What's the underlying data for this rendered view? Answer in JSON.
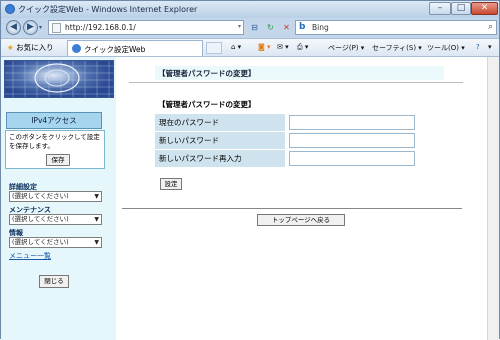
{
  "window": {
    "title": "クイック設定Web - Windows Internet Explorer"
  },
  "address_bar": {
    "url": "http://192.168.0.1/",
    "search_text": "Bing"
  },
  "favorites": {
    "label": "お気に入り"
  },
  "tab": {
    "title": "クイック設定Web"
  },
  "command_bar": {
    "page": "ページ(P) ▾",
    "safety": "セーフティ(S) ▾",
    "tools": "ツール(O) ▾",
    "help": "?",
    "more": "▾"
  },
  "sidebar": {
    "ipv4_label": "IPv4アクセス",
    "save_message": "このボタンをクリックして設定を保存します。",
    "save_button": "保存",
    "sections": [
      {
        "title": "詳細設定",
        "selected": "(選択してください)"
      },
      {
        "title": "メンテナンス",
        "selected": "(選択してください)"
      },
      {
        "title": "情報",
        "selected": "(選択してください)"
      }
    ],
    "menu_list": "メニュー一覧",
    "close_button": "閉じる"
  },
  "main": {
    "header": "【管理者パスワードの変更】",
    "form_title": "【管理者パスワードの変更】",
    "fields": [
      {
        "label": "現在のパスワード",
        "value": ""
      },
      {
        "label": "新しいパスワード",
        "value": ""
      },
      {
        "label": "新しいパスワード再入力",
        "value": ""
      }
    ],
    "set_button": "設定",
    "top_button": "トップページへ戻る"
  },
  "icons": [
    "ie-icon",
    "back-arrow-icon",
    "forward-arrow-icon",
    "page-icon",
    "refresh-icon",
    "stop-icon",
    "bing-icon",
    "search-icon",
    "favorites-star-icon",
    "home-icon",
    "feeds-icon",
    "mail-icon",
    "print-icon",
    "help-icon"
  ],
  "colors": {
    "sidebar_bg": "#e5f7fb",
    "ipv4_bg": "#a6d6ee",
    "label_bg": "#cfe3ef",
    "header_bg": "#ecf9fb"
  }
}
